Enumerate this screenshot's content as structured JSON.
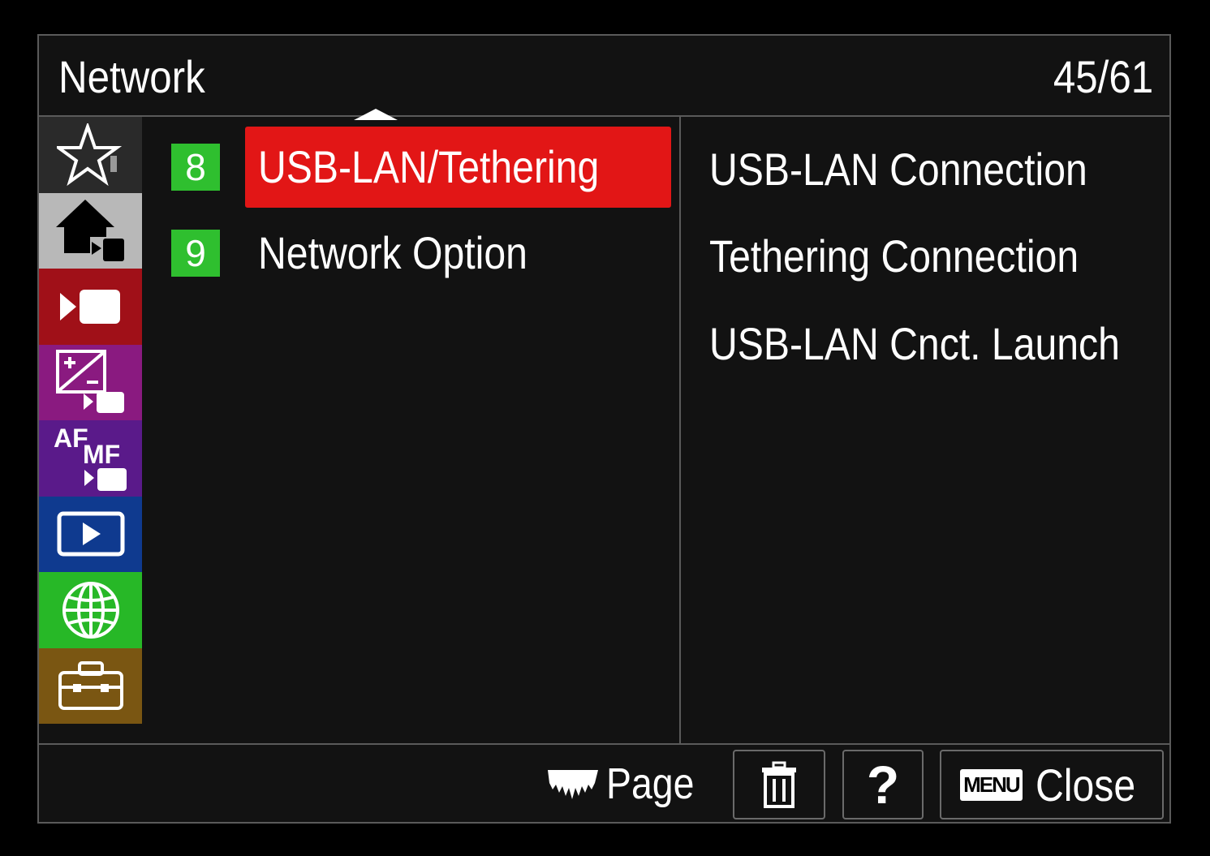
{
  "header": {
    "title": "Network",
    "page_count": "45/61"
  },
  "sidebar": {
    "tabs": [
      {
        "icon": "star-icon",
        "color": "#2a2a2a"
      },
      {
        "icon": "home-movie-icon",
        "color": "#b8b8b8"
      },
      {
        "icon": "movie-camera-icon",
        "color": "#a01018"
      },
      {
        "icon": "exposure-movie-icon",
        "color": "#8a1a80"
      },
      {
        "icon": "af-mf-movie-icon",
        "color": "#5a1a8a"
      },
      {
        "icon": "playback-icon",
        "color": "#0f3a8f"
      },
      {
        "icon": "globe-icon",
        "color": "#27b827"
      },
      {
        "icon": "toolbox-icon",
        "color": "#7a5612"
      }
    ]
  },
  "menu": {
    "items": [
      {
        "number": "8",
        "label": "USB-LAN/Tethering",
        "selected": true
      },
      {
        "number": "9",
        "label": "Network Option",
        "selected": false
      }
    ]
  },
  "submenu": {
    "items": [
      "USB-LAN Connection",
      "Tethering Connection",
      "USB-LAN Cnct. Launch"
    ]
  },
  "footer": {
    "page_label": "Page",
    "help_label": "?",
    "menu_badge": "MENU",
    "close_label": "Close"
  },
  "colors": {
    "accent_red": "#e21616",
    "number_green": "#2fbf2f",
    "border": "#5a5a5a"
  }
}
